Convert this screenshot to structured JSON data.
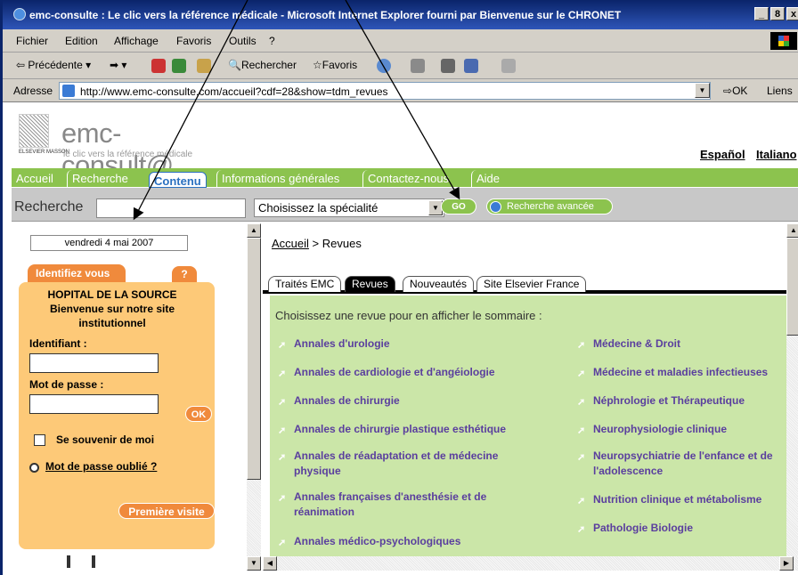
{
  "window": {
    "title": "emc-consulte : Le clic vers la référence médicale - Microsoft Internet Explorer fourni par Bienvenue sur le CHRONET",
    "controls": [
      "_",
      "8",
      "x"
    ]
  },
  "menu": [
    "Fichier",
    "Edition",
    "Affichage",
    "Favoris",
    "Outils",
    "?"
  ],
  "toolbar": {
    "back": "Précédente",
    "search": "Rechercher",
    "favorites": "Favoris"
  },
  "address": {
    "label": "Adresse",
    "url": "http://www.emc-consulte.com/accueil?cdf=28&show=tdm_revues",
    "go": "OK",
    "links": "Liens"
  },
  "header": {
    "logo": "emc-consult@",
    "publisher": "ELSEVIER MASSON",
    "tagline": "le clic vers la référence médicale",
    "languages": [
      "Español",
      "Italiano"
    ]
  },
  "nav": {
    "tabs": [
      "Accueil",
      "Recherche",
      "Contenu",
      "Informations générales",
      "Contactez-nous",
      "Aide"
    ],
    "active": "Contenu"
  },
  "search": {
    "label": "Recherche",
    "specialty": "Choisissez la spécialité",
    "go": "GO",
    "advanced": "Recherche avancée"
  },
  "sidebar": {
    "date": "vendredi 4 mai 2007",
    "identify_tab": "Identifiez vous",
    "help": "?",
    "org_line1": "HOPITAL DE LA SOURCE",
    "org_line2": "Bienvenue sur notre site",
    "org_line3": "institutionnel",
    "login_label": "Identifiant :",
    "password_label": "Mot de passe :",
    "ok": "OK",
    "remember": "Se souvenir de moi",
    "forgot": "Mot de passe oublié ?",
    "first_visit": "Première visite"
  },
  "content": {
    "breadcrumb_home": "Accueil",
    "breadcrumb_sep": " > ",
    "breadcrumb_current": "Revues",
    "tabs": [
      "Traités EMC",
      "Revues",
      "Nouveautés",
      "Site Elsevier France"
    ],
    "active_tab": "Revues",
    "intro": "Choisissez une revue pour en afficher le sommaire :",
    "journals_left": [
      "Annales d'urologie",
      "Annales de cardiologie et d'angéiologie",
      "Annales de chirurgie",
      "Annales de chirurgie plastique esthétique",
      "Annales de réadaptation et de médecine physique",
      "Annales françaises d'anesthésie et de réanimation",
      "Annales médico-psychologiques"
    ],
    "journals_right": [
      "Médecine & Droit",
      "Médecine et maladies infectieuses",
      "Néphrologie et Thérapeutique",
      "Neurophysiologie clinique",
      "Neuropsychiatrie de l'enfance et de l'adolescence",
      "Nutrition clinique et métabolisme",
      "Pathologie Biologie"
    ]
  }
}
